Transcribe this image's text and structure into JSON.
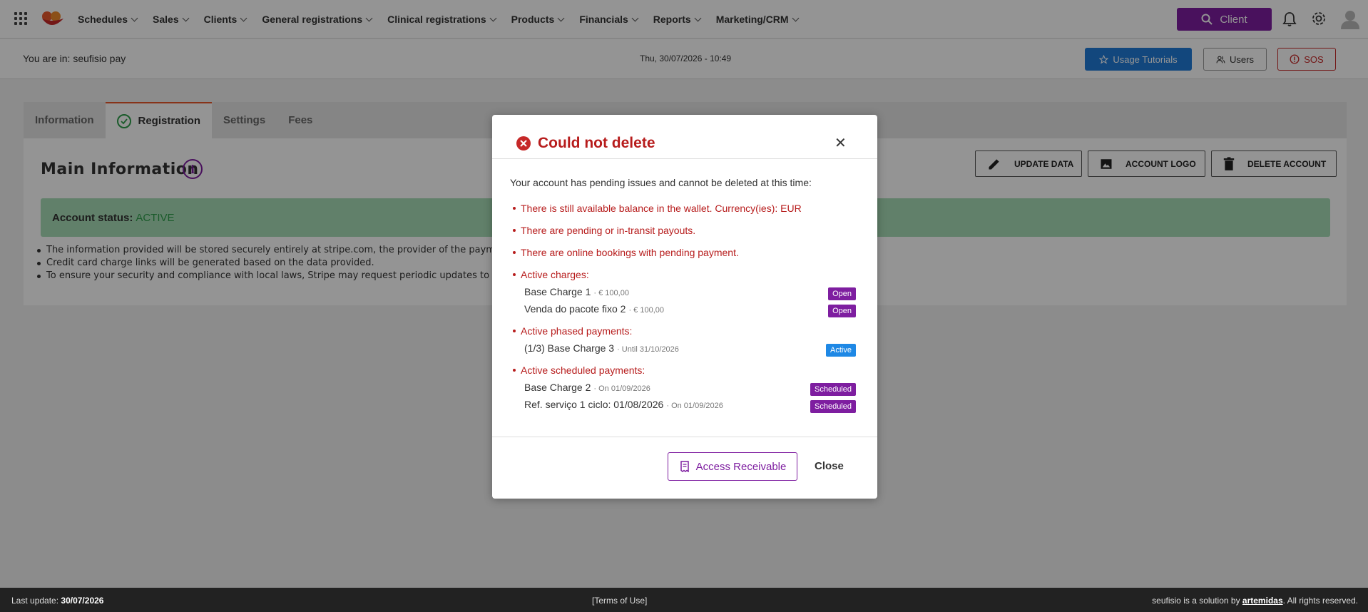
{
  "nav": {
    "items": [
      {
        "label": "Schedules"
      },
      {
        "label": "Sales"
      },
      {
        "label": "Clients"
      },
      {
        "label": "General registrations"
      },
      {
        "label": "Clinical registrations"
      },
      {
        "label": "Products"
      },
      {
        "label": "Financials"
      },
      {
        "label": "Reports"
      },
      {
        "label": "Marketing/CRM"
      }
    ],
    "client_button": "Client"
  },
  "subheader": {
    "location": "You are in: seufisio pay",
    "datetime": "Thu, 30/07/2026 - 10:49",
    "tutorials_label": "Usage Tutorials",
    "users_label": "Users",
    "sos_label": "SOS"
  },
  "tabs": [
    {
      "label": "Information"
    },
    {
      "label": "Registration"
    },
    {
      "label": "Settings"
    },
    {
      "label": "Fees"
    }
  ],
  "main": {
    "title": "Main Information",
    "update_label": "UPDATE DATA",
    "logo_label": "ACCOUNT LOGO",
    "delete_label": "DELETE ACCOUNT",
    "status_label": "Account status:",
    "status_value": "ACTIVE",
    "notes": [
      "The information provided will be stored securely entirely at stripe.com, the provider of the payment",
      "Credit card charge links will be generated based on the data provided.",
      "To ensure your security and compliance with local laws, Stripe may request periodic updates to you"
    ]
  },
  "modal": {
    "title": "Could not delete",
    "intro": "Your account has pending issues and cannot be deleted at this time:",
    "issue_balance": "There is still available balance in the wallet. Currency(ies): EUR",
    "issue_payouts": "There are pending or in-transit payouts.",
    "issue_bookings": "There are online bookings with pending payment.",
    "charges_title": "Active charges:",
    "charges": [
      {
        "name": "Base Charge 1",
        "meta": "· € 100,00",
        "status": "Open"
      },
      {
        "name": "Venda do pacote fixo 2",
        "meta": "· € 100,00",
        "status": "Open"
      }
    ],
    "phased_title": "Active phased payments:",
    "phased": [
      {
        "name": "(1/3) Base Charge 3",
        "meta": "· Until 31/10/2026",
        "status": "Active"
      }
    ],
    "scheduled_title": "Active scheduled payments:",
    "scheduled": [
      {
        "name": "Base Charge 2",
        "meta": "· On 01/09/2026",
        "status": "Scheduled"
      },
      {
        "name": "Ref. serviço 1 ciclo: 01/08/2026",
        "meta": "· On 01/09/2026",
        "status": "Scheduled"
      }
    ],
    "access_label": "Access Receivable",
    "close_label": "Close"
  },
  "footer": {
    "last_update_label": "Last update:",
    "last_update_value": "30/07/2026",
    "terms": "[Terms of Use]",
    "solution_prefix": "seufisio is a solution by",
    "brand": "artemidas",
    "rights": ". All rights reserved."
  },
  "colors": {
    "brand_purple": "#7e1ea0",
    "error_red": "#b71c1c",
    "success_green": "#2e9d4a",
    "info_blue": "#1f7bd8"
  }
}
